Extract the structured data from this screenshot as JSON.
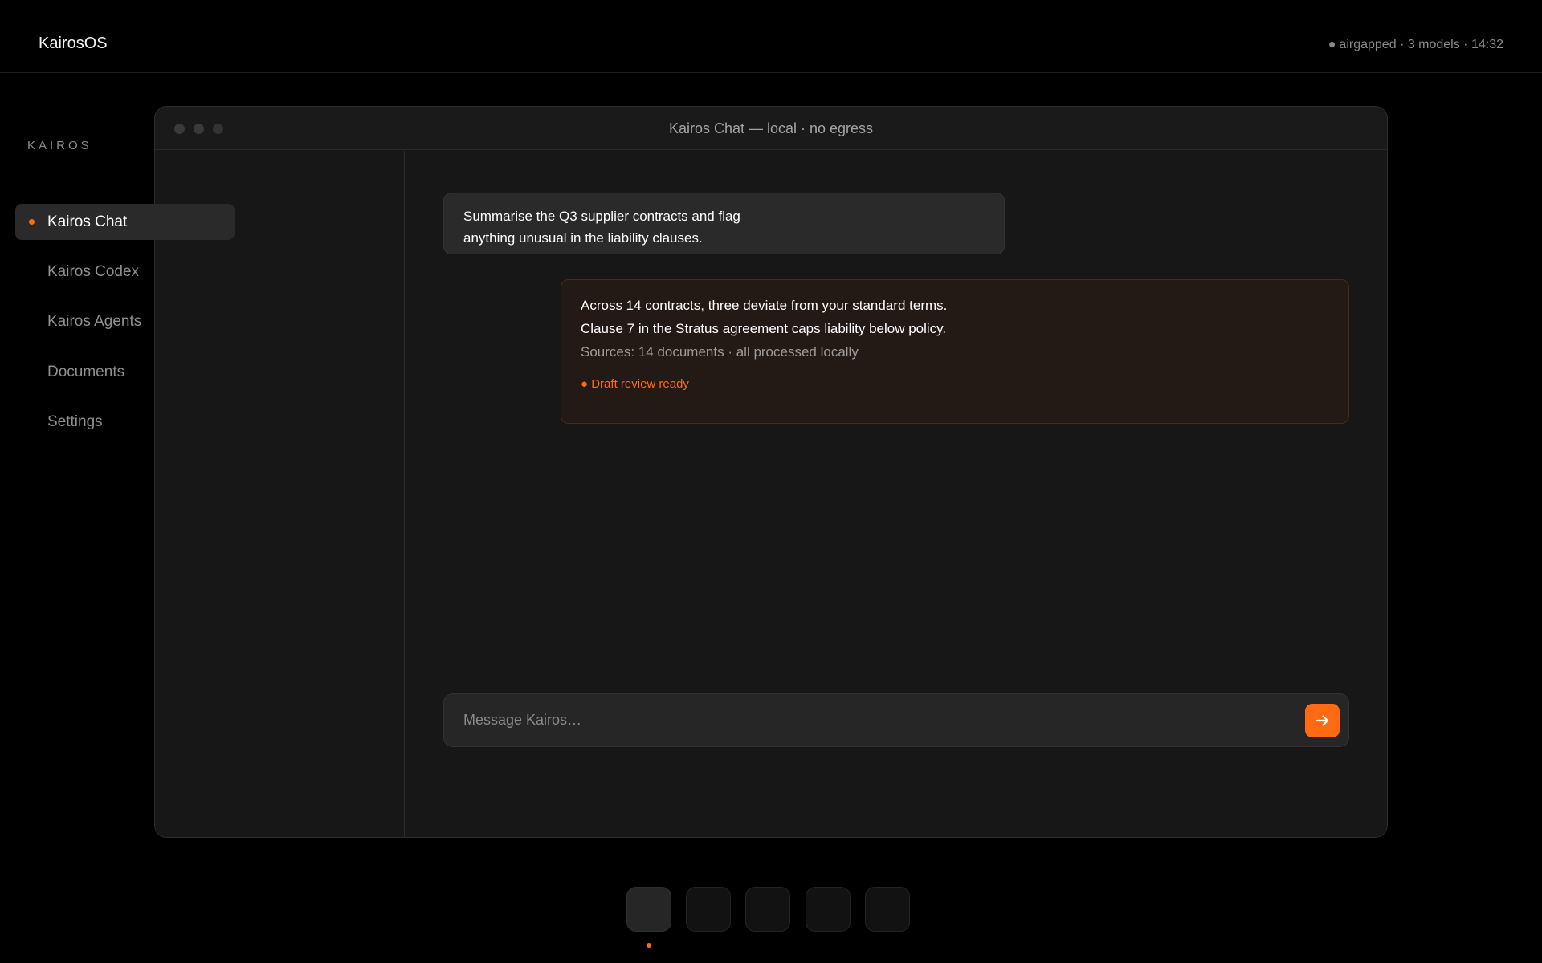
{
  "topbar": {
    "os_name": "KairosOS",
    "status": "airgapped · 3 models · 14:32",
    "status_dot": "●"
  },
  "window": {
    "title": "Kairos Chat — local · no egress"
  },
  "sidebar": {
    "heading": "KAIROS",
    "items": [
      {
        "label": "Kairos Chat",
        "active": true
      },
      {
        "label": "Kairos Codex",
        "active": false
      },
      {
        "label": "Kairos Agents",
        "active": false
      },
      {
        "label": "Documents",
        "active": false
      },
      {
        "label": "Settings",
        "active": false
      }
    ]
  },
  "chat": {
    "user_message": {
      "lines": [
        "Summarise the Q3 supplier contracts and flag",
        "anything unusual in the liability clauses."
      ]
    },
    "assistant_message": {
      "lines": [
        "Across 14 contracts, three deviate from your standard terms.",
        "Clause 7 in the Stratus agreement caps liability below policy."
      ],
      "sources": "Sources: 14 documents · all processed locally",
      "status": "● Draft review ready"
    }
  },
  "composer": {
    "placeholder": "Message Kairos…",
    "value": "",
    "send_icon": "arrow-right-icon"
  },
  "dock": {
    "count": 5,
    "active_index": 0
  },
  "colors": {
    "accent": "#ff6a13",
    "background": "#000000",
    "window": "#171717"
  }
}
